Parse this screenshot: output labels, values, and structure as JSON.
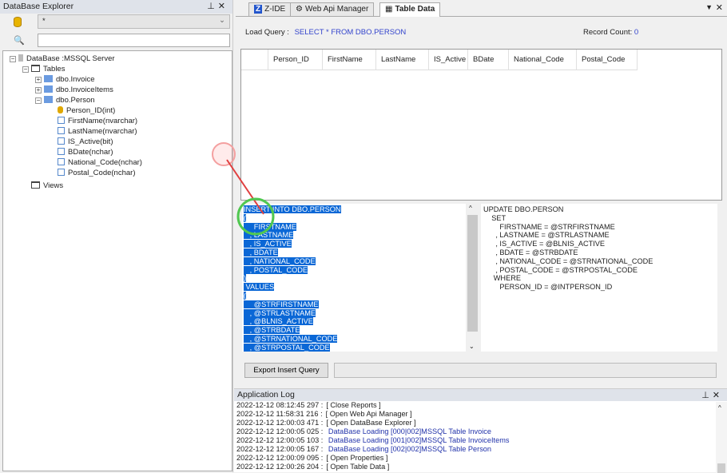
{
  "explorer": {
    "title": "DataBase Explorer",
    "combo_value": "*",
    "search_value": "",
    "tree": {
      "root": "DataBase :MSSQL Server",
      "tables": "Tables",
      "views": "Views",
      "table_items": [
        "dbo.Invoice",
        "dbo.InvoiceItems",
        "dbo.Person"
      ],
      "columns": [
        "Person_ID(int)",
        "FirstName(nvarchar)",
        "LastName(nvarchar)",
        "IS_Active(bit)",
        "BDate(nchar)",
        "National_Code(nchar)",
        "Postal_Code(nchar)"
      ]
    }
  },
  "tabs": [
    {
      "label": "Z-IDE"
    },
    {
      "label": "Web Api Manager"
    },
    {
      "label": "Table Data",
      "active": true
    }
  ],
  "table_data": {
    "load_query_label": "Load Query :",
    "load_query": "SELECT * FROM DBO.PERSON",
    "record_count_label": "Record Count:",
    "record_count": "0",
    "columns": [
      "Person_ID",
      "FirstName",
      "LastName",
      "IS_Active",
      "BDate",
      "National_Code",
      "Postal_Code"
    ],
    "insert_lines": [
      "INSERT INTO DBO.PERSON",
      "(",
      "     FIRSTNAME",
      "   , LASTNAME",
      "   , IS_ACTIVE",
      "   , BDATE",
      "   , NATIONAL_CODE",
      "   , POSTAL_CODE",
      ")",
      " VALUES",
      "(",
      "     @STRFIRSTNAME",
      "   , @STRLASTNAME",
      "   , @BLNIS_ACTIVE",
      "   , @STRBDATE",
      "   , @STRNATIONAL_CODE",
      "   , @STRPOSTAL_CODE"
    ],
    "update_lines": [
      "UPDATE DBO.PERSON",
      "    SET",
      "        FIRSTNAME = @STRFIRSTNAME",
      "      , LASTNAME = @STRLASTNAME",
      "      , IS_ACTIVE = @BLNIS_ACTIVE",
      "      , BDATE = @STRBDATE",
      "      , NATIONAL_CODE = @STRNATIONAL_CODE",
      "      , POSTAL_CODE = @STRPOSTAL_CODE",
      "     WHERE",
      "        PERSON_ID = @INTPERSON_ID"
    ],
    "export_button": "Export Insert Query",
    "export_path": ""
  },
  "log": {
    "title": "Application Log",
    "entries": [
      {
        "time": "2022-12-12 08:12:45 297 :",
        "msg": "[ Close Reports ]",
        "type": "normal"
      },
      {
        "time": "2022-12-12 11:58:31 216 :",
        "msg": "[ Open Web Api Manager ]",
        "type": "normal"
      },
      {
        "time": "2022-12-12 12:00:03 471 :",
        "msg": "[ Open DataBase Explorer ]",
        "type": "normal"
      },
      {
        "time": "2022-12-12 12:00:05 025 :",
        "msg": " DataBase Loading [000|002]MSSQL Table Invoice",
        "type": "info"
      },
      {
        "time": "2022-12-12 12:00:05 103 :",
        "msg": " DataBase Loading [001|002]MSSQL Table InvoiceItems",
        "type": "info"
      },
      {
        "time": "2022-12-12 12:00:05 167 :",
        "msg": " DataBase Loading [002|002]MSSQL Table Person",
        "type": "info"
      },
      {
        "time": "2022-12-12 12:00:09 095 :",
        "msg": "[ Open Properties ]",
        "type": "normal"
      },
      {
        "time": "2022-12-12 12:00:26 204 :",
        "msg": "[ Open Table Data ]",
        "type": "normal"
      }
    ]
  },
  "colors": {
    "selection": "#0a67d6",
    "log_info": "#2233aa",
    "link": "#3344cc"
  }
}
